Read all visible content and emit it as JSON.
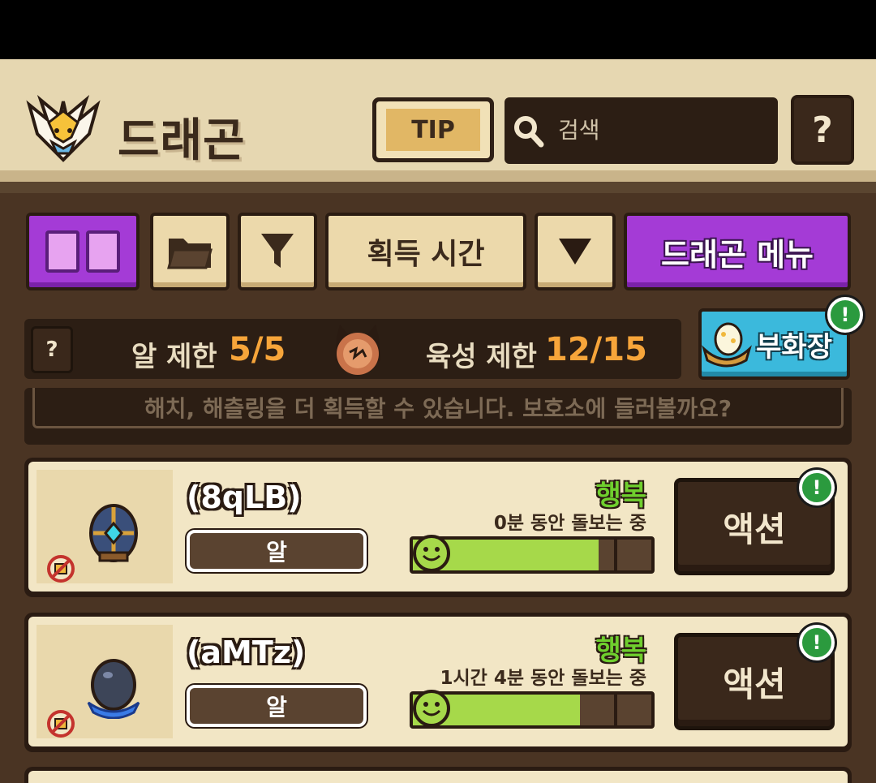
{
  "header": {
    "title": "드래곤",
    "tip_label": "TIP",
    "search_placeholder": "검색",
    "help_label": "?"
  },
  "toolbar": {
    "sort_label": "획득 시간",
    "menu_label": "드래곤 메뉴"
  },
  "limits": {
    "help_label": "?",
    "egg_label": "알 제한",
    "egg_value": "5/5",
    "raise_label": "육성 제한",
    "raise_value": "12/15",
    "hatchery_label": "부화장",
    "badge": "!"
  },
  "notice": "해치, 해츨링을 더 획득할 수 있습니다. 보호소에 들러볼까요?",
  "cards": [
    {
      "name": "(8qLB)",
      "type": "알",
      "mood": "행복",
      "care": "0분 동안 돌보는 중",
      "happiness": 0.78,
      "action": "액션",
      "badge": "!"
    },
    {
      "name": "(aMTz)",
      "type": "알",
      "mood": "행복",
      "care": "1시간 4분 동안 돌보는 중",
      "happiness": 0.7,
      "action": "액션",
      "badge": "!"
    }
  ],
  "colors": {
    "accent_purple": "#a43bd6",
    "hatch_blue": "#3bb9dc",
    "limit_orange": "#f7a53a",
    "mood_green": "#6fcf2e"
  },
  "icons": [
    "dragon-logo-icon",
    "folder-icon",
    "filter-icon",
    "triangle-down-icon",
    "search-icon",
    "dragon-emblem-icon",
    "nest-egg-icon",
    "egg-icon",
    "no-icon",
    "smile-icon"
  ]
}
